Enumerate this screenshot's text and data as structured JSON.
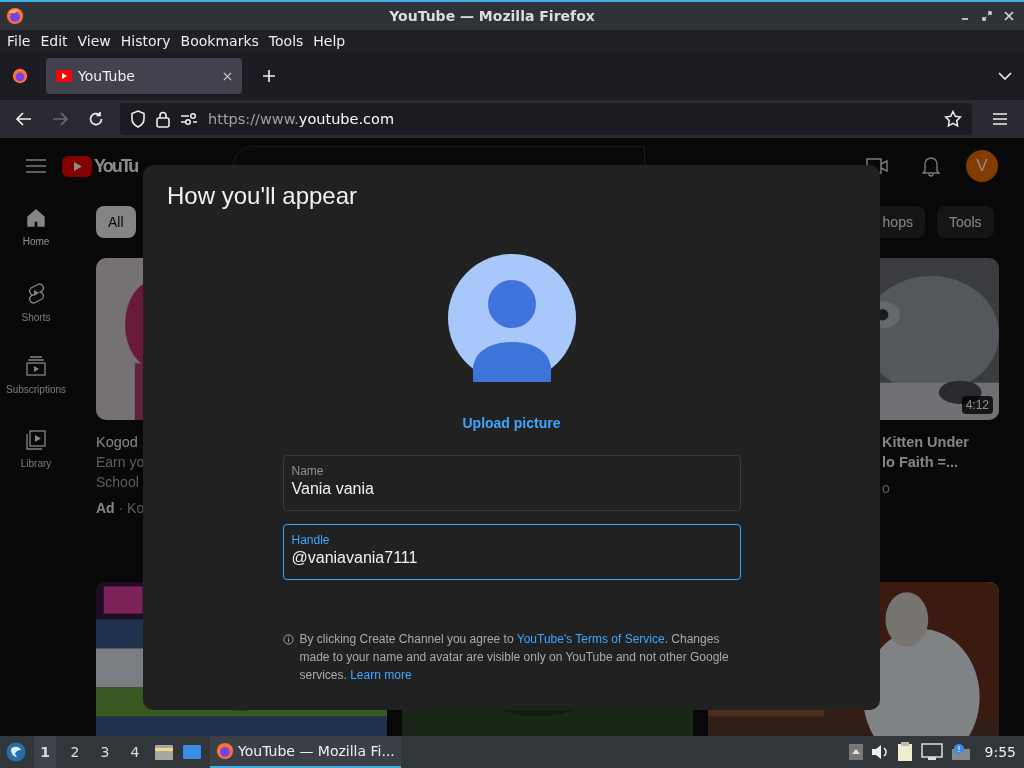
{
  "window": {
    "title": "YouTube — Mozilla Firefox"
  },
  "menu": [
    "File",
    "Edit",
    "View",
    "History",
    "Bookmarks",
    "Tools",
    "Help"
  ],
  "tabs": [
    {
      "label": "YouTube",
      "selected": true
    }
  ],
  "address_bar": {
    "scheme": "https://www.",
    "host": "youtube.com"
  },
  "nav": {
    "back_disabled": false,
    "forward_disabled": true
  },
  "youtube": {
    "logo": "YouTu",
    "avatar": "V",
    "sidebar": [
      {
        "label": "Home",
        "selected": true
      },
      {
        "label": "Shorts",
        "selected": false
      },
      {
        "label": "Subscriptions",
        "selected": false
      },
      {
        "label": "Library",
        "selected": false
      }
    ],
    "chips": [
      {
        "label": "All",
        "selected": true
      },
      {
        "label": "hops",
        "selected": false
      },
      {
        "label": "Tools",
        "selected": false
      }
    ],
    "left_video": {
      "title": "Kogod",
      "desc": [
        "Earn yo",
        "School"
      ],
      "ad": "Ad",
      "channel": "· Ko"
    },
    "right_video": {
      "title": [
        "Kitten Under",
        "lo Faith =..."
      ],
      "meta": "o",
      "duration": "4:12"
    }
  },
  "dialog": {
    "title": "How you'll appear",
    "upload": "Upload picture",
    "fields": [
      {
        "label": "Name",
        "value": "Vania vania",
        "focused": false
      },
      {
        "label": "Handle",
        "value": "@vaniavania7111",
        "focused": true
      }
    ],
    "notice": {
      "before": "By clicking Create Channel you agree to ",
      "link": "YouTube's Terms of Service",
      "after": ". Changes made to your name and avatar are visible only on YouTube and not other Google services. ",
      "link2": "Learn more"
    }
  },
  "taskbar": {
    "workspaces": [
      {
        "label": "1",
        "selected": true
      },
      {
        "label": "2",
        "selected": false
      },
      {
        "label": "3",
        "selected": false
      },
      {
        "label": "4",
        "selected": false
      }
    ],
    "tasks": [
      {
        "label": "YouTube — Mozilla Fi...",
        "selected": true
      }
    ],
    "clock": "9:55"
  }
}
